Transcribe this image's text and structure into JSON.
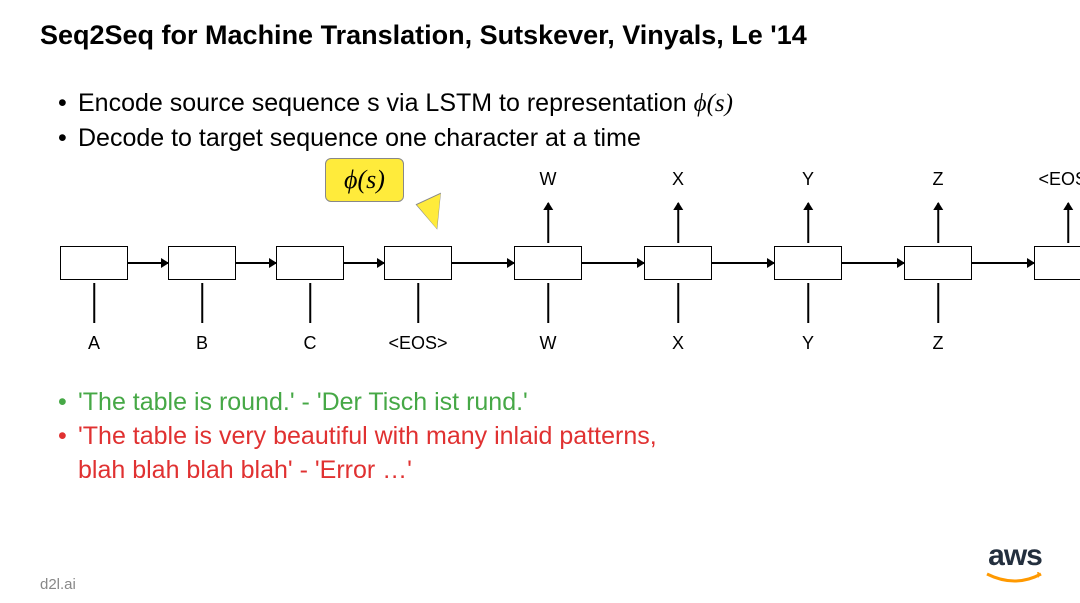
{
  "title": "Seq2Seq for Machine Translation, Sutskever, Vinyals, Le '14",
  "bullets": {
    "b1_prefix": "Encode source sequence s via LSTM to representation ",
    "b1_phi": "ϕ(s)",
    "b2": "Decode to target sequence one character at a time"
  },
  "diagram": {
    "phi_annotation": "ϕ(s)",
    "top_labels": [
      "",
      "",
      "",
      "",
      "W",
      "X",
      "Y",
      "Z",
      "<EOS>"
    ],
    "bottom_labels": [
      "A",
      "B",
      "C",
      "<EOS>",
      "W",
      "X",
      "Y",
      "Z"
    ],
    "box_count_encoder": 4,
    "box_count_decoder": 5
  },
  "examples": {
    "good": "'The table is round.' - 'Der Tisch ist rund.'",
    "bad_line1": "'The table is very beautiful with many inlaid patterns,",
    "bad_line2": "blah blah blah blah' - 'Error …'"
  },
  "footer": {
    "credit": "d2l.ai",
    "logo": "aws"
  }
}
